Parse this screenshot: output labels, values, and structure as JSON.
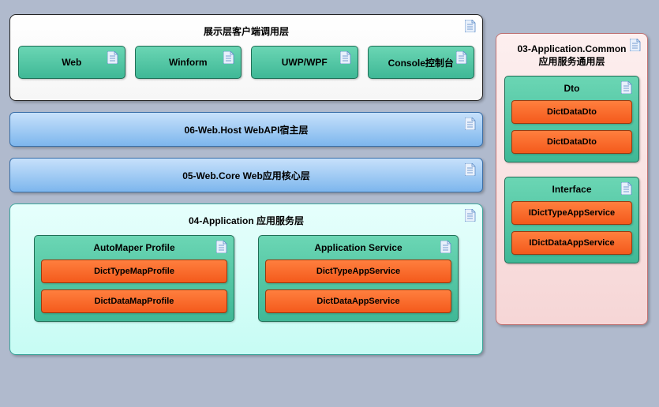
{
  "presentation": {
    "title": "展示层客户端调用层",
    "clients": [
      "Web",
      "Winform",
      "UWP/WPF",
      "Console控制台"
    ]
  },
  "webHost": {
    "title": "06-Web.Host WebAPI宿主层"
  },
  "webCore": {
    "title": "05-Web.Core Web应用核心层"
  },
  "application": {
    "title": "04-Application 应用服务层",
    "automapper": {
      "title": "AutoMaper Profile",
      "items": [
        "DictTypeMapProfile",
        "DictDataMapProfile"
      ]
    },
    "service": {
      "title": "Application Service",
      "items": [
        "DictTypeAppService",
        "DictDataAppService"
      ]
    }
  },
  "common": {
    "title_line1": "03-Application.Common",
    "title_line2": "应用服务通用层",
    "dto": {
      "title": "Dto",
      "items": [
        "DictDataDto",
        "DictDataDto"
      ]
    },
    "interface": {
      "title": "Interface",
      "items": [
        "IDictTypeAppService",
        "IDictDataAppService"
      ]
    }
  }
}
